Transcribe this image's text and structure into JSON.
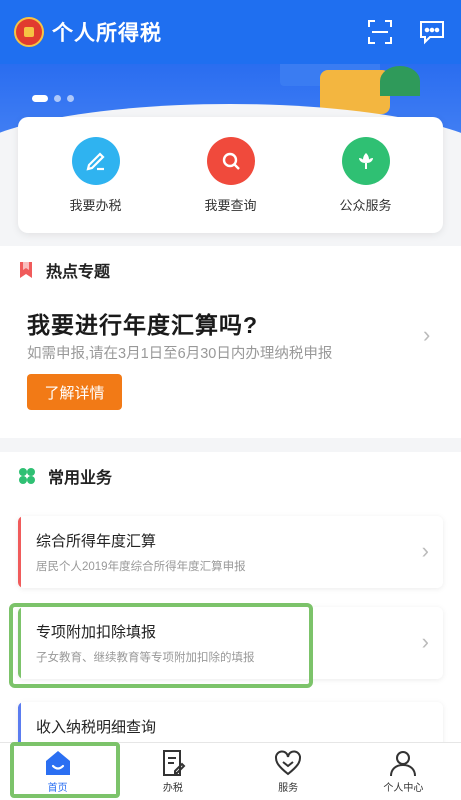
{
  "header": {
    "title": "个人所得税",
    "icons": [
      "emblem-icon",
      "scan-icon",
      "message-icon"
    ]
  },
  "banner": {
    "carousel_pages": 3,
    "active_page": 1
  },
  "quick_actions": [
    {
      "label": "我要办税",
      "icon": "edit-icon",
      "color": "#2fb3f0"
    },
    {
      "label": "我要查询",
      "icon": "search-icon",
      "color": "#f04a3c"
    },
    {
      "label": "公众服务",
      "icon": "flower-icon",
      "color": "#2fc073"
    }
  ],
  "hot_topic": {
    "section_title": "热点专题",
    "title": "我要进行年度汇算吗?",
    "subtitle": "如需申报,请在3月1日至6月30日内办理纳税申报",
    "button_label": "了解详情"
  },
  "common_business": {
    "section_title": "常用业务",
    "items": [
      {
        "title": "综合所得年度汇算",
        "subtitle": "居民个人2019年度综合所得年度汇算申报",
        "bar_color": "#f05b5b"
      },
      {
        "title": "专项附加扣除填报",
        "subtitle": "子女教育、继续教育等专项附加扣除的填报",
        "bar_color": "#7cc36a"
      },
      {
        "title": "收入纳税明细查询",
        "subtitle": "",
        "bar_color": "#5b7cf0"
      }
    ]
  },
  "tabbar": {
    "tabs": [
      {
        "label": "首页",
        "icon": "home-icon",
        "active": true
      },
      {
        "label": "办税",
        "icon": "tax-form-icon",
        "active": false
      },
      {
        "label": "服务",
        "icon": "service-heart-icon",
        "active": false
      },
      {
        "label": "个人中心",
        "icon": "user-icon",
        "active": false
      }
    ]
  },
  "colors": {
    "primary": "#1f6ff0",
    "accent_orange": "#f27a16",
    "highlight_green": "#7cc36a"
  }
}
